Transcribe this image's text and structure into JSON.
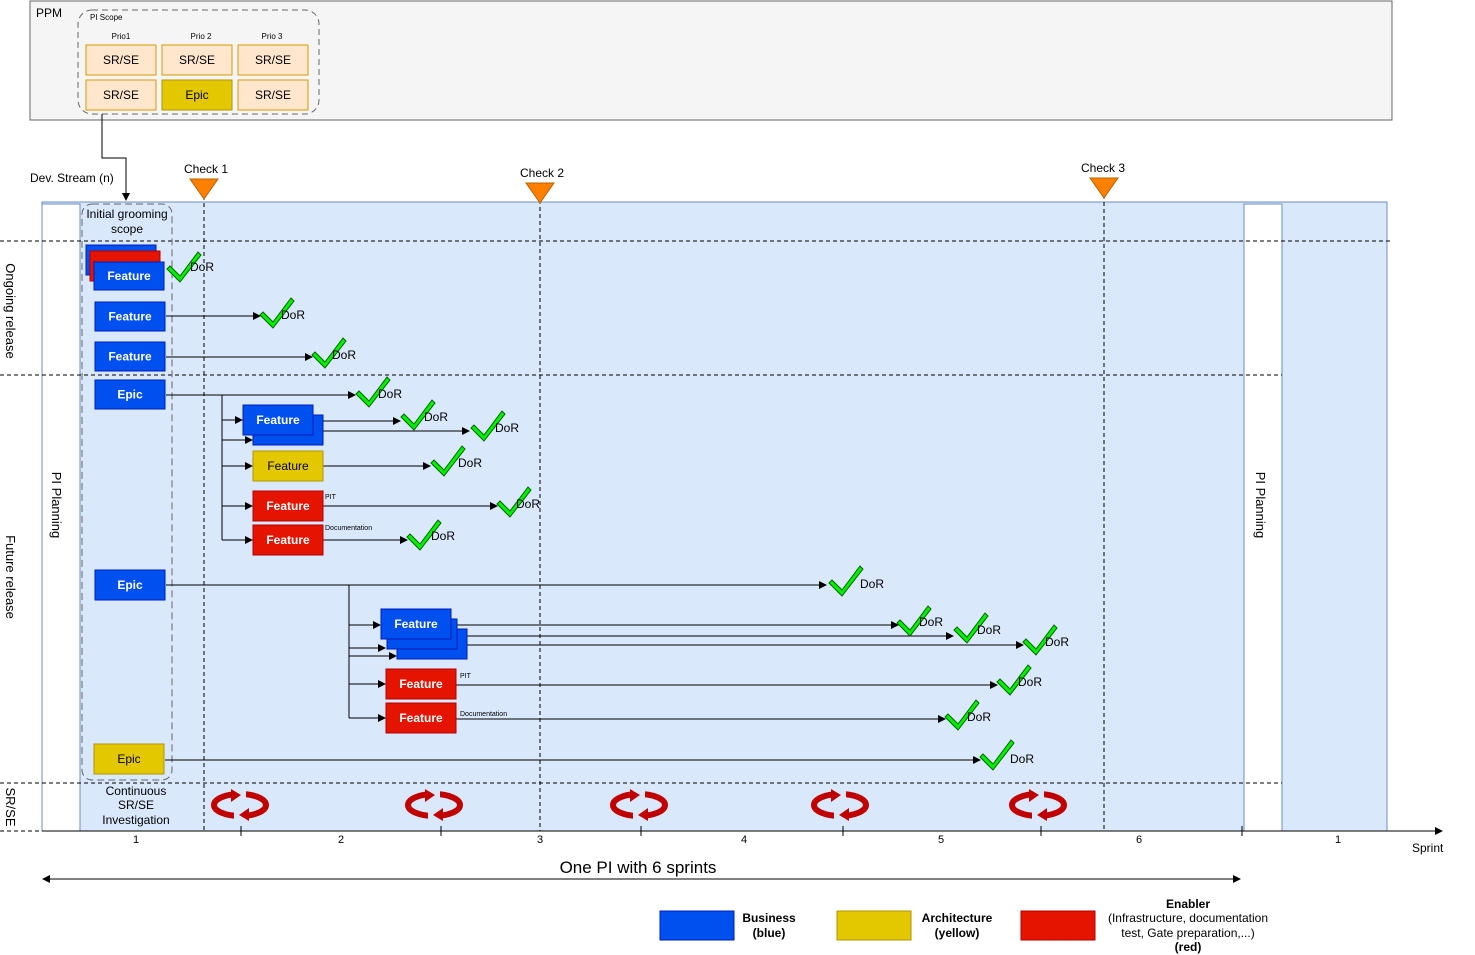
{
  "ppm": {
    "label": "PPM",
    "scope_label": "PI Scope",
    "prio_headers": [
      "Prio1",
      "Prio 2",
      "Prio 3"
    ],
    "grid": [
      [
        {
          "text": "SR/SE",
          "kind": "srse"
        },
        {
          "text": "SR/SE",
          "kind": "srse"
        },
        {
          "text": "SR/SE",
          "kind": "srse"
        }
      ],
      [
        {
          "text": "SR/SE",
          "kind": "srse"
        },
        {
          "text": "Epic",
          "kind": "architecture"
        },
        {
          "text": "SR/SE",
          "kind": "srse"
        }
      ]
    ]
  },
  "stream_label": "Dev. Stream (n)",
  "grooming_label": "Initial grooming scope",
  "checks": [
    "Check 1",
    "Check 2",
    "Check 3"
  ],
  "row_labels": {
    "ongoing": "Ongoing release",
    "future": "Future release",
    "srse": "SR/SE"
  },
  "pi_planning": "PI Planning",
  "continuous_label": "Continuous SR/SE Investigation",
  "dor": "DoR",
  "feature_label": "Feature",
  "epic_label": "Epic",
  "pit_label": "PIT",
  "documentation_label": "Documentation",
  "axis": {
    "label": "Sprint",
    "ticks": [
      "1",
      "2",
      "3",
      "4",
      "5",
      "6",
      "1"
    ]
  },
  "pi_span": "One PI with 6 sprints",
  "legend": [
    {
      "name": "Business",
      "sub": "(blue)",
      "color": "#0050ef"
    },
    {
      "name": "Architecture",
      "sub": "(yellow)",
      "color": "#e3c800"
    },
    {
      "name": "Enabler",
      "sub": "(Infrastructure, documentation test, Gate preparation,...)",
      "sub_lines": [
        "(Infrastructure, documentation",
        "test, Gate preparation,...)"
      ],
      "sub2": "(red)",
      "color": "#e51400"
    }
  ],
  "colors": {
    "business": "#0050ef",
    "architecture": "#e3c800",
    "enabler": "#e51400",
    "srse_fill": "#ffe6cc",
    "srse_stroke": "#d79b00",
    "band": "#dae8fc",
    "band_stroke": "#6c8ebf",
    "check": "#ff8000",
    "tick": "#00ff00"
  }
}
